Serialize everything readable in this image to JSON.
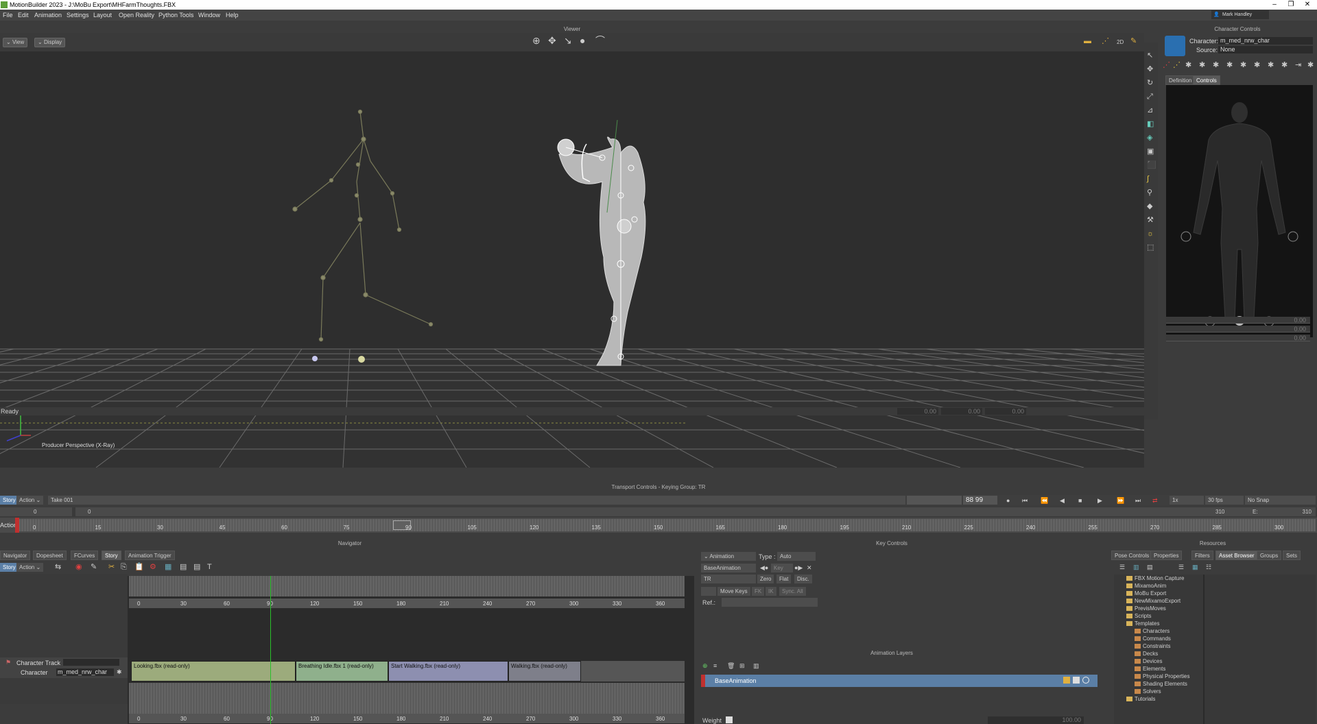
{
  "titlebar": {
    "title": "MotionBuilder 2023 - J:\\MoBu Export\\MHFarmThoughts.FBX"
  },
  "menu": [
    "File",
    "Edit",
    "Animation",
    "Settings",
    "Layout",
    "Open Reality",
    "Python Tools",
    "Window",
    "Help"
  ],
  "user": "Mark Handley",
  "viewer": {
    "title": "Viewer",
    "view_btn": "View",
    "display_btn": "Display",
    "camera_label": "Producer Perspective (X-Ray)",
    "status": "Ready",
    "readouts": [
      "0.00",
      "0.00",
      "0.00"
    ]
  },
  "character_controls": {
    "title": "Character Controls",
    "character_label": "Character:",
    "character_value": "m_med_nrw_char",
    "source_label": "Source:",
    "source_value": "None",
    "tabs": [
      "Definition",
      "Controls"
    ],
    "active_tab": "Controls",
    "fields": [
      "0.00",
      "0.00",
      "0.00"
    ]
  },
  "transport": {
    "title": "Transport Controls  -  Keying Group: TR",
    "story_btn": "Story",
    "action_btn": "Action",
    "take": "Take 001",
    "frame_display": "88 99",
    "speed": "1x",
    "fps": "30 fps",
    "snap": "No Snap",
    "start_val": "0",
    "start_val2": "0",
    "end_val": "310",
    "end_field": "E:",
    "end_val2": "310",
    "mode_label": "Action",
    "ruler_ticks": [
      "0",
      "15",
      "30",
      "45",
      "60",
      "75",
      "90",
      "105",
      "120",
      "135",
      "150",
      "165",
      "180",
      "195",
      "210",
      "225",
      "240",
      "255",
      "270",
      "285",
      "300"
    ]
  },
  "navigator": {
    "title": "Navigator",
    "tabs": [
      "Navigator",
      "Dopesheet",
      "FCurves",
      "Story",
      "Animation Trigger"
    ],
    "active_tab": "Story",
    "story_btn": "Story",
    "action_btn": "Action",
    "ruler_ticks": [
      "0",
      "30",
      "60",
      "90",
      "120",
      "150",
      "180",
      "210",
      "240",
      "270",
      "300",
      "330",
      "360"
    ],
    "track_name": "Character Track",
    "character_label": "Character",
    "character_value": "m_med_nrw_char",
    "clips": [
      "Looking.fbx (read-only)",
      "Breathing Idle.fbx 1 (read-only)",
      "Start Walking.fbx (read-only)",
      "Walking.fbx (read-only)"
    ]
  },
  "key_controls": {
    "title": "Key Controls",
    "animation_btn": "Animation",
    "type_label": "Type :",
    "type_value": "Auto",
    "layer_value": "BaseAnimation",
    "key_btn": "Key",
    "tr_value": "TR",
    "zero_btn": "Zero",
    "flat_btn": "Flat",
    "disc_btn": "Disc.",
    "move_keys_btn": "Move Keys",
    "fk_btn": "FK",
    "ik_btn": "IK",
    "sync_btn": "Sync. All",
    "ref_label": "Ref.:"
  },
  "animation_layers": {
    "title": "Animation Layers",
    "layer": "BaseAnimation",
    "weight_label": "Weight",
    "weight_value": "100.00"
  },
  "resources": {
    "title": "Resources",
    "tabs": [
      "Pose Controls",
      "Properties",
      "Filters",
      "Asset Browser",
      "Groups",
      "Sets"
    ],
    "active_tab": "Asset Browser",
    "tree": [
      "FBX Motion Capture",
      "MixamoAnim",
      "MoBu Export",
      "NewMixamoExport",
      "PrevisMoves",
      "Scripts",
      "Templates",
      "Characters",
      "Commands",
      "Constraints",
      "Decks",
      "Devices",
      "Elements",
      "Physical Properties",
      "Shading Elements",
      "Solvers",
      "Tutorials"
    ]
  },
  "colors": {
    "accent_green": "#5e9e3a",
    "layer_blue": "#5b7fa6",
    "clip_green": "#9cab7c",
    "clip_purple": "#8d8fb0"
  }
}
